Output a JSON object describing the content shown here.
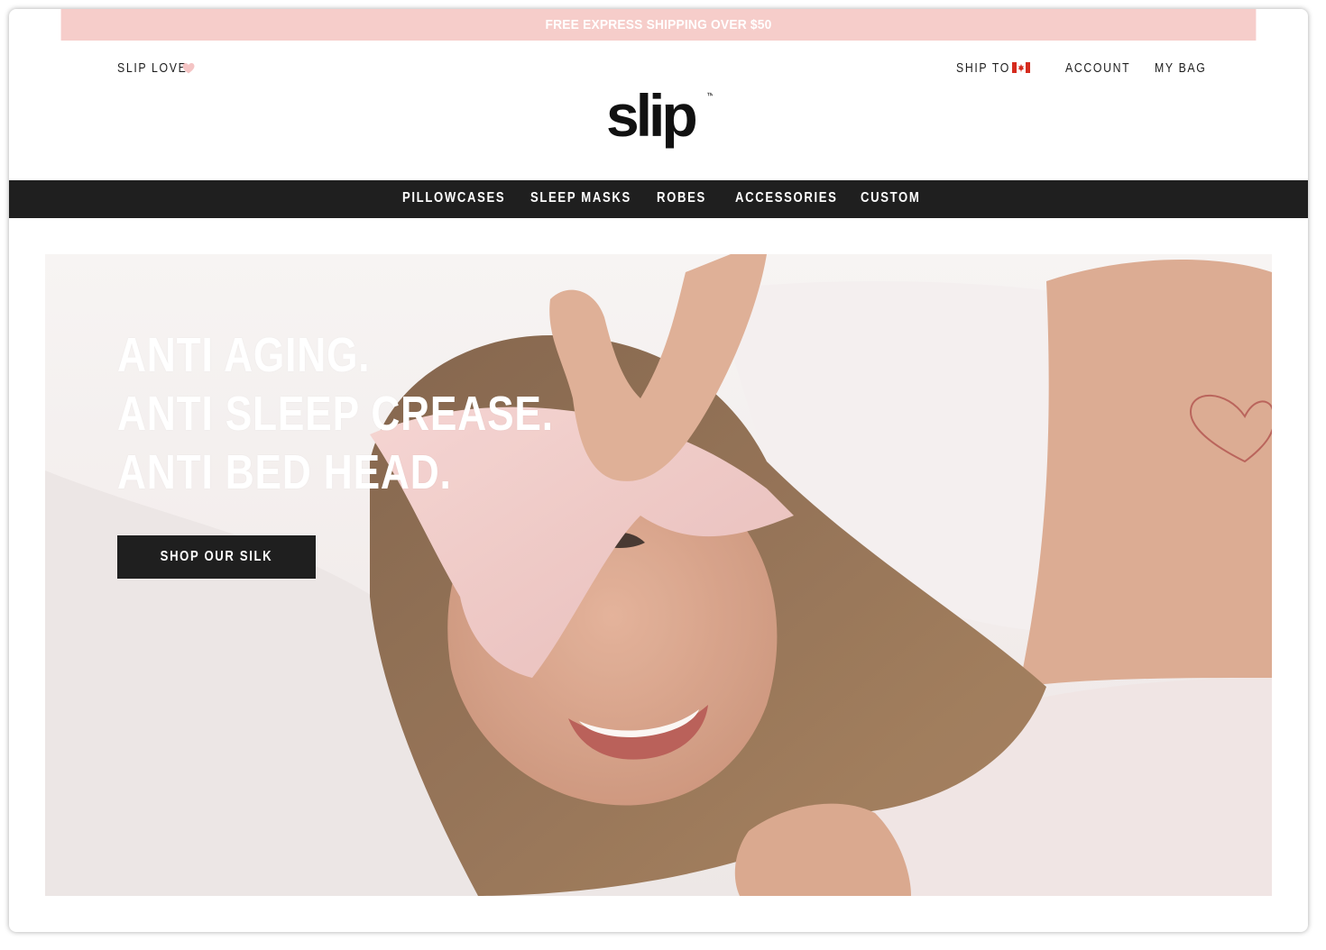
{
  "promo": {
    "text": "FREE EXPRESS SHIPPING OVER $50",
    "background": "#f6cdca"
  },
  "header": {
    "slip_love": "SLIP LOVE",
    "heart_icon": "heart-icon",
    "ship_to": "SHIP TO",
    "flag_icon": "canada-flag-icon",
    "account": "ACCOUNT",
    "my_bag": "MY BAG",
    "logo_text": "slip",
    "logo_mark": "™"
  },
  "nav": {
    "items": [
      "PILLOWCASES",
      "SLEEP MASKS",
      "ROBES",
      "ACCESSORIES",
      "CUSTOM"
    ],
    "background": "#1f1f1f"
  },
  "hero": {
    "lines": [
      "ANTI AGING.",
      "ANTI SLEEP CREASE.",
      "ANTI BED HEAD."
    ],
    "cta": "SHOP OUR SILK",
    "accent": "#f2c4c3"
  }
}
